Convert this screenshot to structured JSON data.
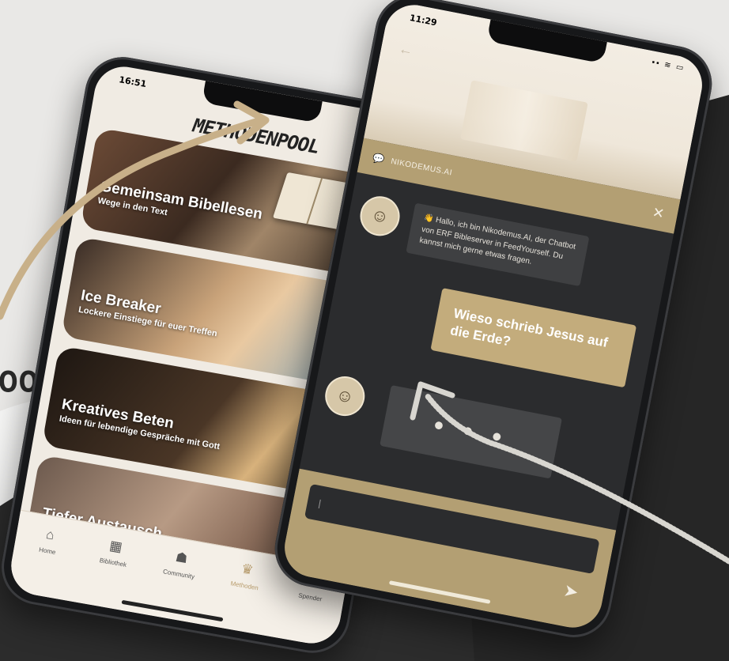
{
  "background": {
    "partial_word": "OOL",
    "colors": {
      "accent": "#c3ac7c",
      "page": "#e9e8e6",
      "texture": "#2a2a2a"
    }
  },
  "left_phone": {
    "status_time": "16:51",
    "status_icons": "▪▪ ≋ ▭",
    "header_title": "METHODENPOOL",
    "cards": [
      {
        "title": "Gemeinsam Bibellesen",
        "subtitle": "Wege in den Text"
      },
      {
        "title": "Ice Breaker",
        "subtitle": "Lockere Einstiege für euer Treffen"
      },
      {
        "title": "Kreatives Beten",
        "subtitle": "Ideen für lebendige Gespräche mit Gott"
      },
      {
        "title": "Tiefer Austausch",
        "subtitle": ""
      }
    ],
    "tabs": [
      {
        "label": "Home",
        "icon": "home-icon",
        "glyph": "⌂"
      },
      {
        "label": "Bibliothek",
        "icon": "library-icon",
        "glyph": "▦"
      },
      {
        "label": "Community",
        "icon": "community-icon",
        "glyph": "☗"
      },
      {
        "label": "Methoden",
        "icon": "methods-icon",
        "glyph": "♛"
      },
      {
        "label": "Spender",
        "icon": "donate-icon",
        "glyph": "✎"
      }
    ],
    "active_tab": "Methoden"
  },
  "right_phone": {
    "status_time": "11:29",
    "status_icons": "▪▪ ≋ ▭",
    "chat_title": "NIKODEMUS.AI",
    "bot_message": "👋 Hallo, ich bin Nikodemus.AI, der Chatbot von ERF Bibleserver in FeedYourself. Du kannst mich gerne etwas fragen.",
    "user_message": "Wieso schrieb Jesus auf die Erde?",
    "typing_indicator": "• • •",
    "send_icon": "➤"
  }
}
